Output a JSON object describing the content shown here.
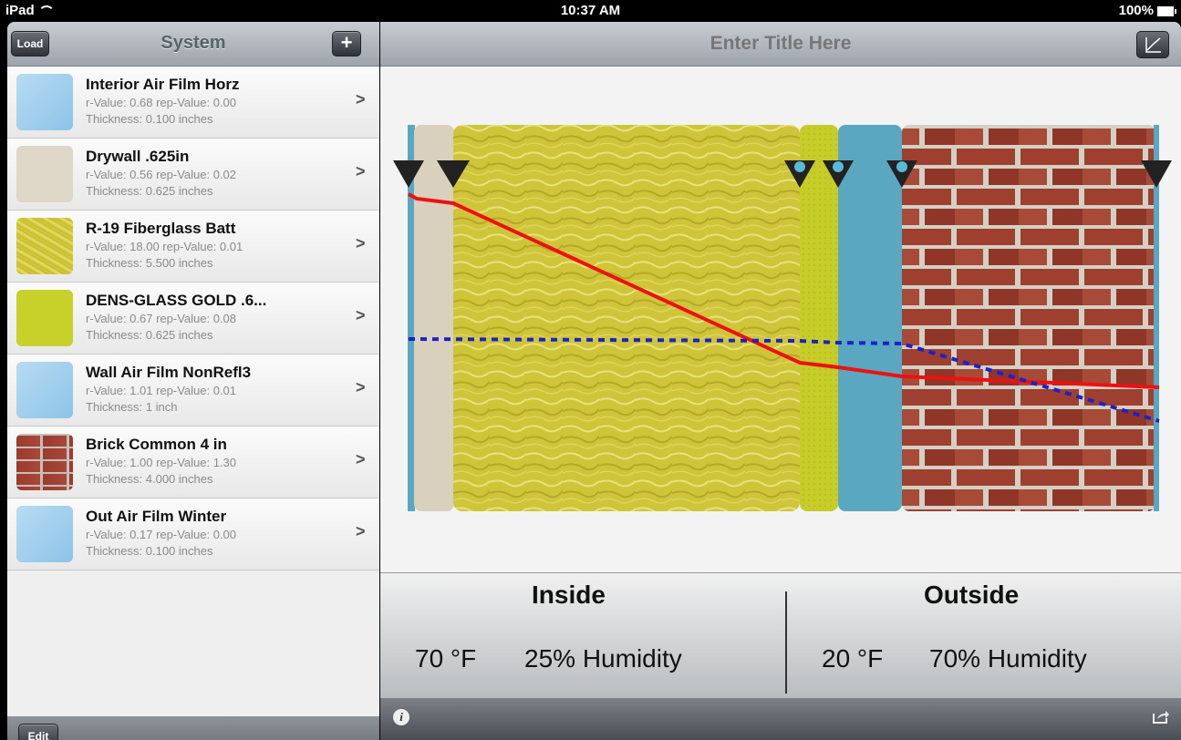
{
  "status": {
    "device": "iPad",
    "time": "10:37 AM",
    "battery": "100%"
  },
  "system": {
    "title": "System",
    "load_label": "Load",
    "add_label": "+",
    "edit_label": "Edit",
    "layers": [
      {
        "name": "Interior Air Film Horz",
        "values": "r-Value: 0.68   rep-Value: 0.00",
        "thickness": "Thickness: 0.100 inches",
        "swatch": "air"
      },
      {
        "name": "Drywall .625in",
        "values": "r-Value: 0.56   rep-Value: 0.02",
        "thickness": "Thickness: 0.625 inches",
        "swatch": "drywall"
      },
      {
        "name": "R-19 Fiberglass Batt",
        "values": "r-Value: 18.00   rep-Value: 0.01",
        "thickness": "Thickness: 5.500 inches",
        "swatch": "fiberglass"
      },
      {
        "name": "DENS-GLASS GOLD .6...",
        "values": "r-Value: 0.67   rep-Value: 0.08",
        "thickness": "Thickness: 0.625 inches",
        "swatch": "densglass"
      },
      {
        "name": "Wall Air Film NonRefl3",
        "values": "r-Value: 1.01   rep-Value: 0.01",
        "thickness": "Thickness: 1 inch",
        "swatch": "air"
      },
      {
        "name": "Brick Common 4 in",
        "values": "r-Value: 1.00   rep-Value: 1.30",
        "thickness": "Thickness: 4.000 inches",
        "swatch": "brick"
      },
      {
        "name": "Out Air Film Winter",
        "values": "r-Value: 0.17   rep-Value: 0.00",
        "thickness": "Thickness: 0.100 inches",
        "swatch": "air"
      }
    ]
  },
  "main": {
    "title": "Enter Title Here",
    "inside": {
      "label": "Inside",
      "temp": "70 °F",
      "humidity": "25% Humidity"
    },
    "outside": {
      "label": "Outside",
      "temp": "20 °F",
      "humidity": "70% Humidity"
    }
  },
  "colors": {
    "temperature_line": "#ee1111",
    "dewpoint_line": "#1a22cc",
    "air": "#5aa7c2",
    "drywall": "#d9d0be",
    "fiberglass": "#cfc53a",
    "densglass": "#c6cc28",
    "brick": "#9a3b2c"
  },
  "icons": {
    "chart": "line-chart-icon",
    "info": "info-icon",
    "share": "share-icon",
    "chevron": "chevron-right-icon",
    "marker": "triangle-marker-icon",
    "warning": "warning-icon"
  }
}
